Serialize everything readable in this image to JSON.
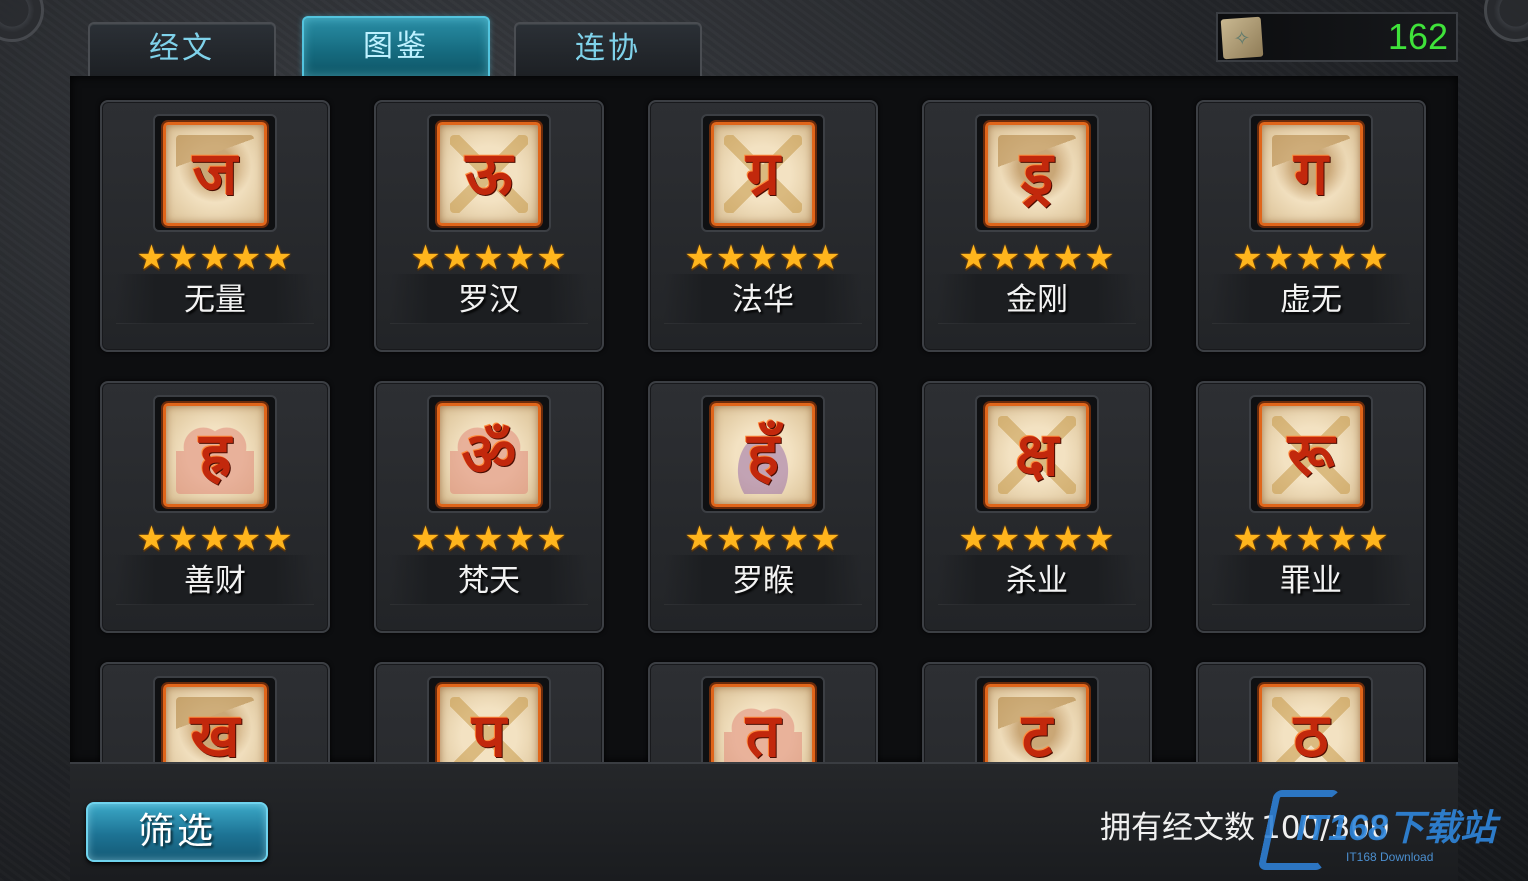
{
  "tabs": [
    {
      "label": "经文",
      "active": false
    },
    {
      "label": "图鉴",
      "active": true
    },
    {
      "label": "连协",
      "active": false
    }
  ],
  "currency": {
    "icon": "scroll-icon",
    "value": "162"
  },
  "cards": [
    {
      "name": "无量",
      "stars": 5,
      "glyph": "ज",
      "motif": "shield"
    },
    {
      "name": "罗汉",
      "stars": 5,
      "glyph": "ऊ",
      "motif": "swords"
    },
    {
      "name": "法华",
      "stars": 5,
      "glyph": "ग्र",
      "motif": "swords"
    },
    {
      "name": "金刚",
      "stars": 5,
      "glyph": "ड्र",
      "motif": "shield"
    },
    {
      "name": "虚无",
      "stars": 5,
      "glyph": "ग",
      "motif": "shield"
    },
    {
      "name": "善财",
      "stars": 5,
      "glyph": "ह्र",
      "motif": "heart"
    },
    {
      "name": "梵天",
      "stars": 5,
      "glyph": "ॐ",
      "motif": "heart"
    },
    {
      "name": "罗睺",
      "stars": 5,
      "glyph": "हँ",
      "motif": "flame"
    },
    {
      "name": "杀业",
      "stars": 5,
      "glyph": "क्ष",
      "motif": "swords"
    },
    {
      "name": "罪业",
      "stars": 5,
      "glyph": "रू",
      "motif": "swords"
    },
    {
      "name": "",
      "stars": 0,
      "glyph": "ख",
      "motif": "shield"
    },
    {
      "name": "",
      "stars": 0,
      "glyph": "प",
      "motif": "swords"
    },
    {
      "name": "",
      "stars": 0,
      "glyph": "त",
      "motif": "heart"
    },
    {
      "name": "",
      "stars": 0,
      "glyph": "ट",
      "motif": "shield"
    },
    {
      "name": "",
      "stars": 0,
      "glyph": "ठ",
      "motif": "swords"
    }
  ],
  "filter_button": {
    "label": "筛选"
  },
  "owned": {
    "label": "拥有经文数",
    "count": "100/300"
  },
  "watermark": {
    "text": "IT168下载站",
    "sub": "IT168 Download"
  },
  "colors": {
    "accent": "#2a8ea6",
    "currency": "#3fe23a",
    "star": "#ffb51d",
    "glyph": "#c2280c"
  }
}
